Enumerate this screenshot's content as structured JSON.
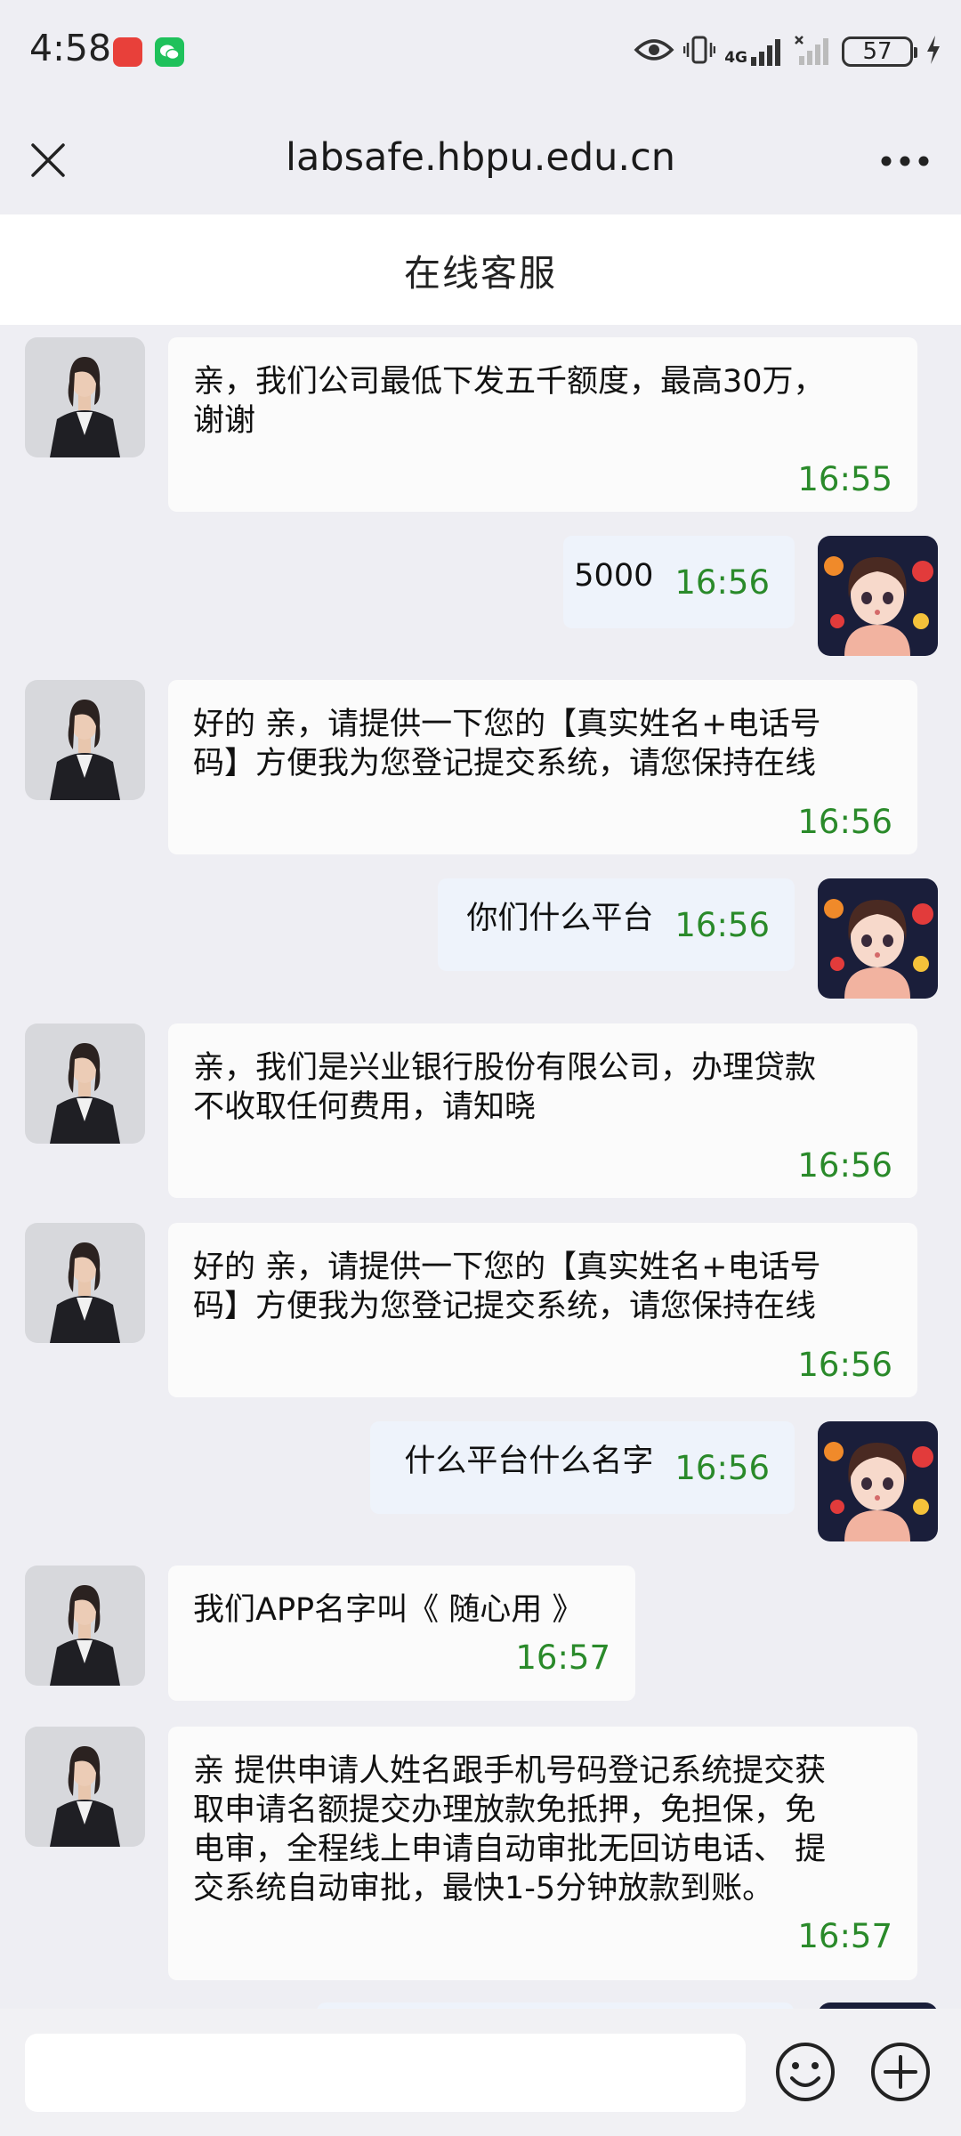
{
  "status_bar": {
    "time": "4:58",
    "network": "4G",
    "battery": "57",
    "icons": [
      "huawei-store-icon",
      "wechat-icon",
      "eye-icon",
      "vibrate-icon",
      "signal-icon",
      "signal-off-icon",
      "charging-icon"
    ],
    "colors": {
      "huawei_store": "#e8403a",
      "wechat": "#1fc15b"
    }
  },
  "browser": {
    "url": "labsafe.hbpu.edu.cn",
    "close_icon": "close-icon",
    "more_icon": "more-icon"
  },
  "page": {
    "title": "在线客服"
  },
  "messages": [
    {
      "side": "left",
      "text": "亲，我们公司最低下发五千额度，最高30万，\n谢谢",
      "time": "16:55"
    },
    {
      "side": "right",
      "text": "5000",
      "time": "16:56"
    },
    {
      "side": "left",
      "text": "好的 亲，请提供一下您的【真实姓名+电话号\n码】方便我为您登记提交系统，请您保持在线",
      "time": "16:56"
    },
    {
      "side": "right",
      "text": "你们什么平台",
      "time": "16:56"
    },
    {
      "side": "left",
      "text": "亲，我们是兴业银行股份有限公司，办理贷款\n不收取任何费用，请知晓",
      "time": "16:56"
    },
    {
      "side": "left",
      "text": "好的 亲，请提供一下您的【真实姓名+电话号\n码】方便我为您登记提交系统，请您保持在线",
      "time": "16:56"
    },
    {
      "side": "right",
      "text": "什么平台什么名字",
      "time": "16:56"
    },
    {
      "side": "left",
      "text": "我们APP名字叫《 随心用 》",
      "time": "16:57"
    },
    {
      "side": "left",
      "text": "亲 提供申请人姓名跟手机号码登记系统提交获\n取申请名额提交办理放款免抵押，免担保，免\n电审，全程线上申请自动审批无回访电话、 提\n交系统自动审批，最快1-5分钟放款到账。",
      "time": "16:57"
    }
  ],
  "input": {
    "placeholder": "",
    "emoji_icon": "emoji-icon",
    "plus_icon": "plus-icon"
  },
  "colors": {
    "background": "#eeeef3",
    "left_bubble": "#fbfbfb",
    "right_bubble": "#eef3fb",
    "timestamp": "#2a8a2a"
  }
}
